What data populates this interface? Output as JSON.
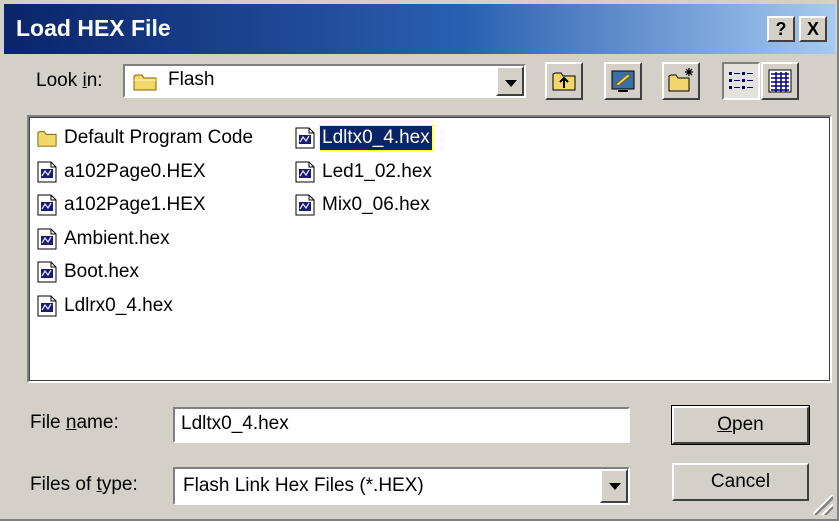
{
  "window": {
    "title": "Load HEX File",
    "help_label": "?",
    "close_label": "X"
  },
  "look_in": {
    "label_pre": "Look ",
    "label_accel": "i",
    "label_post": "n:",
    "value": "Flash"
  },
  "toolbar": {
    "buttons": [
      "up-one-level",
      "desktop",
      "create-new-folder",
      "list-view",
      "details-view"
    ],
    "active": "list-view"
  },
  "files": {
    "column1": [
      {
        "name": "Default Program Code",
        "type": "folder"
      },
      {
        "name": "a102Page0.HEX",
        "type": "hex"
      },
      {
        "name": "a102Page1.HEX",
        "type": "hex"
      },
      {
        "name": "Ambient.hex",
        "type": "hex"
      },
      {
        "name": "Boot.hex",
        "type": "hex"
      },
      {
        "name": "Ldlrx0_4.hex",
        "type": "hex"
      }
    ],
    "column2": [
      {
        "name": "Ldltx0_4.hex",
        "type": "hex",
        "selected": true
      },
      {
        "name": "Led1_02.hex",
        "type": "hex"
      },
      {
        "name": "Mix0_06.hex",
        "type": "hex"
      }
    ]
  },
  "file_name": {
    "label_pre": "File ",
    "label_accel": "n",
    "label_post": "ame:",
    "value": "Ldltx0_4.hex"
  },
  "file_type": {
    "label_pre": "Files of ",
    "label_accel": "t",
    "label_post": "ype:",
    "value": "Flash Link Hex Files (*.HEX)"
  },
  "buttons": {
    "open_accel": "O",
    "open_rest": "pen",
    "cancel": "Cancel"
  },
  "colors": {
    "title_start": "#0a246a",
    "title_end": "#a6caf0",
    "face": "#d4d0c8",
    "selection": "#0a246a"
  }
}
